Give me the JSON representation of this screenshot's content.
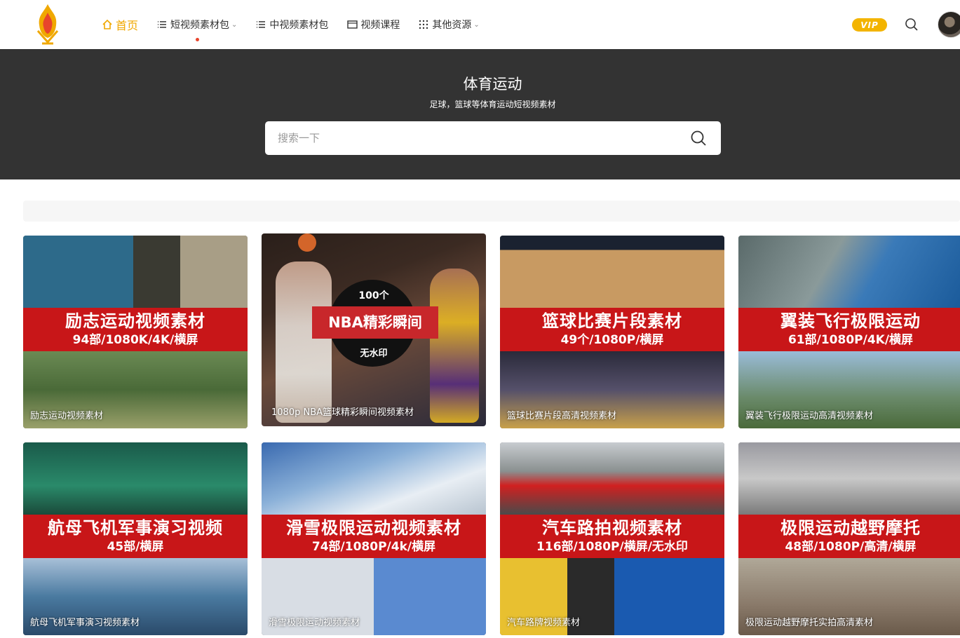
{
  "header": {
    "nav": [
      {
        "label": "首页",
        "icon": "home-icon",
        "active": true,
        "dropdown": false
      },
      {
        "label": "短视频素材包",
        "icon": "list-icon",
        "active": false,
        "dropdown": true,
        "dot": true
      },
      {
        "label": "中视频素材包",
        "icon": "list-icon",
        "active": false,
        "dropdown": false
      },
      {
        "label": "视频课程",
        "icon": "screen-icon",
        "active": false,
        "dropdown": false
      },
      {
        "label": "其他资源",
        "icon": "grid-icon",
        "active": false,
        "dropdown": true
      }
    ],
    "vip_label": "VIP"
  },
  "banner": {
    "title": "体育运动",
    "subtitle": "足球，篮球等体育运动短视频素材",
    "search_placeholder": "搜索一下"
  },
  "cards": [
    {
      "title": "励志运动视频素材",
      "subtitle": "94部/1080K/4K/横屏",
      "caption": "励志运动视频素材"
    },
    {
      "title": "NBA精彩瞬间",
      "count": "100个",
      "watermark": "无水印",
      "caption": "1080p  NBA篮球精彩瞬间视频素材"
    },
    {
      "title": "篮球比赛片段素材",
      "subtitle": "49个/1080P/横屏",
      "caption": "篮球比赛片段高清视频素材"
    },
    {
      "title": "翼装飞行极限运动",
      "subtitle": "61部/1080P/4K/横屏",
      "caption": "翼装飞行极限运动高清视频素材"
    },
    {
      "title": "航母飞机军事演习视频",
      "subtitle": "45部/横屏",
      "caption": "航母飞机军事演习视频素材"
    },
    {
      "title": "滑雪极限运动视频素材",
      "subtitle": "74部/1080P/4k/横屏",
      "caption": "滑雪极限运动视频素材"
    },
    {
      "title": "汽车路拍视频素材",
      "subtitle": "116部/1080P/横屏/无水印",
      "caption": "汽车路牌视频素材"
    },
    {
      "title": "极限运动越野摩托",
      "subtitle": "48部/1080P/高清/横屏",
      "caption": "极限运动越野摩托实拍高清素材"
    }
  ],
  "colors": {
    "accent": "#f0a800",
    "banner_bg": "#333333",
    "card_band": "#c81618",
    "vip": "#f3b400"
  }
}
